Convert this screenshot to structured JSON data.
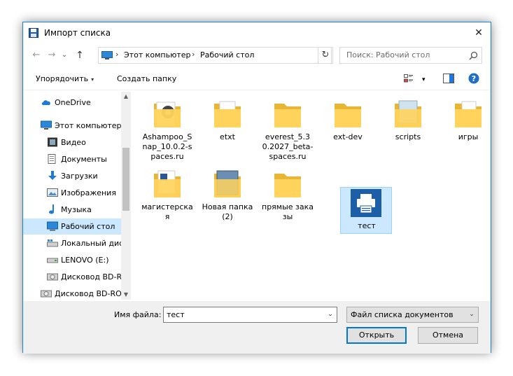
{
  "window": {
    "title": "Импорт списка",
    "close_glyph": "✕"
  },
  "nav": {
    "back_glyph": "←",
    "forward_glyph": "→",
    "history_glyph": "⌄",
    "up_glyph": "↑",
    "breadcrumbs": [
      "Этот компьютер",
      "Рабочий стол"
    ],
    "separator": "›",
    "dropdown_glyph": "⌄",
    "refresh_glyph": "↻"
  },
  "search": {
    "placeholder": "Поиск: Рабочий стол"
  },
  "toolbar": {
    "organize_label": "Упорядочить",
    "organize_caret": "▾",
    "new_folder_label": "Создать папку",
    "view_caret": "▾",
    "help_glyph": "?"
  },
  "sidebar": {
    "items": [
      {
        "label": "OneDrive",
        "icon": "cloud-icon"
      },
      {
        "label": "Этот компьютер",
        "icon": "computer-icon"
      },
      {
        "label": "Видео",
        "icon": "video-icon"
      },
      {
        "label": "Документы",
        "icon": "documents-icon"
      },
      {
        "label": "Загрузки",
        "icon": "downloads-icon"
      },
      {
        "label": "Изображения",
        "icon": "images-icon"
      },
      {
        "label": "Музыка",
        "icon": "music-icon"
      },
      {
        "label": "Рабочий стол",
        "icon": "desktop-icon",
        "selected": true
      },
      {
        "label": "Локальный диск (C:)",
        "icon": "drive-icon"
      },
      {
        "label": "LENOVO (E:)",
        "icon": "drive-icon"
      },
      {
        "label": "Дисковод BD-ROM",
        "icon": "optical-drive-icon"
      },
      {
        "label": "Дисковод BD-ROM",
        "icon": "optical-drive-icon"
      }
    ],
    "scroll_up": "▲",
    "scroll_down": "▼"
  },
  "files": [
    {
      "name": "Ashampoo_Snap_10.0.2-spaces.ru",
      "type": "folder"
    },
    {
      "name": "etxt",
      "type": "folder"
    },
    {
      "name": "everest_5.30.2027_beta-spaces.ru",
      "type": "folder"
    },
    {
      "name": "ext-dev",
      "type": "folder"
    },
    {
      "name": "scripts",
      "type": "folder"
    },
    {
      "name": "игры",
      "type": "folder"
    },
    {
      "name": "магистерская",
      "type": "folder"
    },
    {
      "name": "Новая папка (2)",
      "type": "folder"
    },
    {
      "name": "прямые заказы",
      "type": "folder"
    },
    {
      "name": "тест",
      "type": "file",
      "selected": true
    }
  ],
  "bottom": {
    "filename_label": "Имя файла:",
    "filename_value": "тест",
    "filename_dd": "⌄",
    "filetype_value": "Файл списка документов",
    "filetype_dd": "⌄",
    "open_label": "Открыть",
    "cancel_label": "Отмена"
  },
  "colors": {
    "accent": "#0078d7",
    "selection": "#cce8ff",
    "folder": "#ffd35c",
    "folder_dark": "#e8b634"
  }
}
